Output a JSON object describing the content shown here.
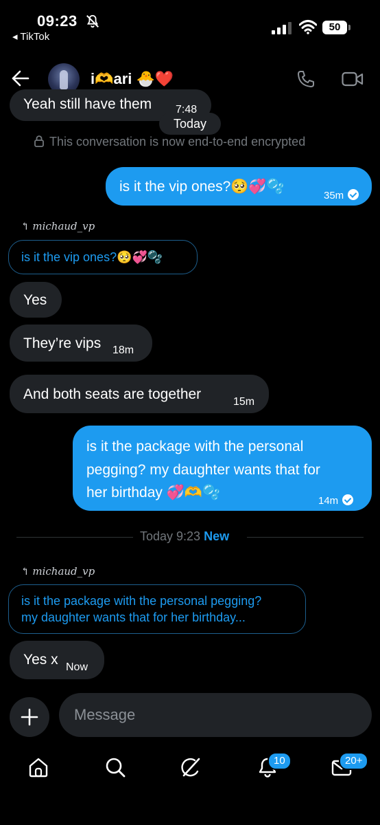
{
  "status_bar": {
    "time": "09:23",
    "back_app": "◂ TikTok",
    "battery": "50"
  },
  "header": {
    "contact_name": "i🫶ari 🐣❤️"
  },
  "messages": {
    "cut_text": "Yeah still have them",
    "cut_time": "7:48",
    "day_label": "Today",
    "encrypted_notice": "This conversation is now end-to-end encrypted",
    "out1_text": "is it the vip ones?🥺💞🫧",
    "out1_time": "35m",
    "reply1_label": "michaud_vp",
    "reply1_text": "is it the vip ones?🥺💞🫧",
    "in1_text": "Yes",
    "in2_text": "They’re vips",
    "in2_time": "18m",
    "in3_text": "And both seats are together",
    "in3_time": "15m",
    "out2_line1": "is it the package with the personal",
    "out2_line2": "pegging? my daughter wants that for",
    "out2_line3": "her birthday 💞🫶🫧",
    "out2_time": "14m",
    "divider_time": "Today 9:23",
    "divider_new": "New",
    "reply2_label": "michaud_vp",
    "reply2_line1": "is it the package with the personal pegging?",
    "reply2_line2": "my daughter wants that for her birthday...",
    "in4_text": "Yes x",
    "in4_time": "Now"
  },
  "composer": {
    "placeholder": "Message"
  },
  "nav": {
    "notifications_badge": "10",
    "messages_badge": "20+"
  },
  "colors": {
    "accent": "#1d9bf0",
    "incoming_bubble": "#202327",
    "background": "#000000"
  }
}
